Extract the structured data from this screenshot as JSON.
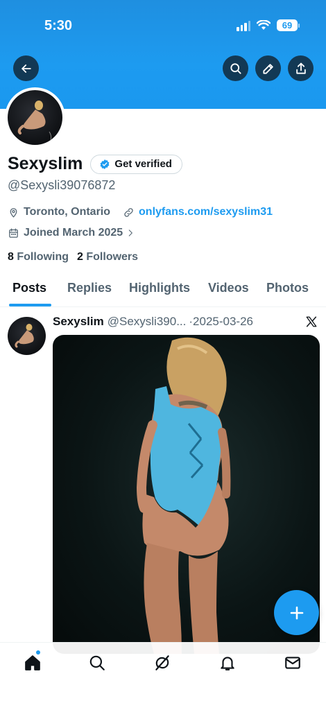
{
  "status_bar": {
    "time": "5:30",
    "battery": "69"
  },
  "profile": {
    "display_name": "Sexyslim",
    "verify_label": "Get verified",
    "handle": "@Sexysli39076872",
    "location": "Toronto, Ontario",
    "website": "onlyfans.com/sexyslim31",
    "joined": "Joined March 2025",
    "following_count": "8",
    "following_label": "Following",
    "followers_count": "2",
    "followers_label": "Followers"
  },
  "tabs": [
    {
      "label": "Posts",
      "active": true
    },
    {
      "label": "Replies"
    },
    {
      "label": "Highlights"
    },
    {
      "label": "Videos"
    },
    {
      "label": "Photos"
    }
  ],
  "post": {
    "name": "Sexyslim",
    "handle": "@Sexysli390...",
    "date": "·2025-03-26"
  },
  "nav": {
    "items": [
      "home-icon",
      "search-icon",
      "grok-icon",
      "notifications-icon",
      "messages-icon"
    ]
  },
  "colors": {
    "accent": "#1d9bf0",
    "text_primary": "#0f1419",
    "text_secondary": "#536471"
  }
}
